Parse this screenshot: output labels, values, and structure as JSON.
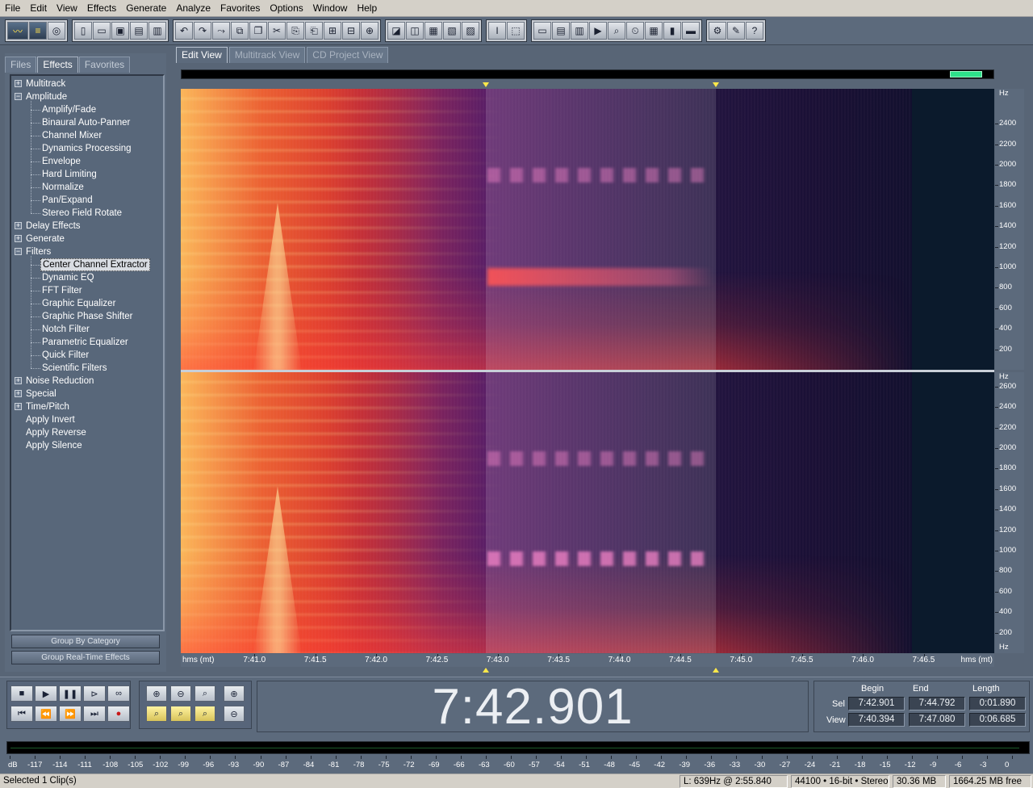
{
  "menu": [
    "File",
    "Edit",
    "View",
    "Effects",
    "Generate",
    "Analyze",
    "Favorites",
    "Options",
    "Window",
    "Help"
  ],
  "left_tabs": [
    "Files",
    "Effects",
    "Favorites"
  ],
  "left_active_tab": "Effects",
  "tree": [
    {
      "label": "Multitrack",
      "level": 0,
      "expander": "+"
    },
    {
      "label": "Amplitude",
      "level": 0,
      "expander": "-"
    },
    {
      "label": "Amplify/Fade",
      "level": 1
    },
    {
      "label": "Binaural Auto-Panner",
      "level": 1
    },
    {
      "label": "Channel Mixer",
      "level": 1
    },
    {
      "label": "Dynamics Processing",
      "level": 1
    },
    {
      "label": "Envelope",
      "level": 1
    },
    {
      "label": "Hard Limiting",
      "level": 1
    },
    {
      "label": "Normalize",
      "level": 1
    },
    {
      "label": "Pan/Expand",
      "level": 1
    },
    {
      "label": "Stereo Field Rotate",
      "level": 1
    },
    {
      "label": "Delay Effects",
      "level": 0,
      "expander": "+"
    },
    {
      "label": "Generate",
      "level": 0,
      "expander": "+"
    },
    {
      "label": "Filters",
      "level": 0,
      "expander": "-"
    },
    {
      "label": "Center Channel Extractor",
      "level": 1,
      "selected": true
    },
    {
      "label": "Dynamic EQ",
      "level": 1
    },
    {
      "label": "FFT Filter",
      "level": 1
    },
    {
      "label": "Graphic Equalizer",
      "level": 1
    },
    {
      "label": "Graphic Phase Shifter",
      "level": 1
    },
    {
      "label": "Notch Filter",
      "level": 1
    },
    {
      "label": "Parametric Equalizer",
      "level": 1
    },
    {
      "label": "Quick Filter",
      "level": 1
    },
    {
      "label": "Scientific Filters",
      "level": 1
    },
    {
      "label": "Noise Reduction",
      "level": 0,
      "expander": "+"
    },
    {
      "label": "Special",
      "level": 0,
      "expander": "+"
    },
    {
      "label": "Time/Pitch",
      "level": 0,
      "expander": "+"
    },
    {
      "label": "Apply Invert",
      "level": 0
    },
    {
      "label": "Apply Reverse",
      "level": 0
    },
    {
      "label": "Apply Silence",
      "level": 0
    }
  ],
  "left_buttons": {
    "group_by_category": "Group By Category",
    "group_realtime": "Group Real-Time Effects"
  },
  "view_tabs": [
    "Edit View",
    "Multitrack View",
    "CD Project View"
  ],
  "view_active_tab": "Edit View",
  "hz_unit": "Hz",
  "hz_labels_top": [
    "2400",
    "2200",
    "2000",
    "1800",
    "1600",
    "1400",
    "1200",
    "1000",
    "800",
    "600",
    "400",
    "200"
  ],
  "hz_labels_bottom": [
    "2600",
    "2400",
    "2200",
    "2000",
    "1800",
    "1600",
    "1400",
    "1200",
    "1000",
    "800",
    "600",
    "400",
    "200"
  ],
  "time_unit": "hms (mt)",
  "time_labels": [
    "7:41.0",
    "7:41.5",
    "7:42.0",
    "7:42.5",
    "7:43.0",
    "7:43.5",
    "7:44.0",
    "7:44.5",
    "7:45.0",
    "7:45.5",
    "7:46.0",
    "7:46.5"
  ],
  "time_view_start": 7.40394,
  "time_view_end": 7.4708,
  "selection_start_fraction": 0.375,
  "selection_end_fraction": 0.6575,
  "current_time": "7:42.901",
  "selview": {
    "headers": {
      "begin": "Begin",
      "end": "End",
      "length": "Length"
    },
    "sel_label": "Sel",
    "view_label": "View",
    "sel": {
      "begin": "7:42.901",
      "end": "7:44.792",
      "length": "0:01.890"
    },
    "view": {
      "begin": "7:40.394",
      "end": "7:47.080",
      "length": "0:06.685"
    }
  },
  "db_labels": [
    "dB",
    "-117",
    "-114",
    "-111",
    "-108",
    "-105",
    "-102",
    "-99",
    "-96",
    "-93",
    "-90",
    "-87",
    "-84",
    "-81",
    "-78",
    "-75",
    "-72",
    "-69",
    "-66",
    "-63",
    "-60",
    "-57",
    "-54",
    "-51",
    "-48",
    "-45",
    "-42",
    "-39",
    "-36",
    "-33",
    "-30",
    "-27",
    "-24",
    "-21",
    "-18",
    "-15",
    "-12",
    "-9",
    "-6",
    "-3",
    "0"
  ],
  "status": {
    "clips": "Selected 1 Clip(s)",
    "cursor": "L: 639Hz @  2:55.840",
    "format": "44100 • 16-bit • Stereo",
    "size": "30.36 MB",
    "free": "1664.25 MB free"
  },
  "colors": {
    "panel": "#5c6a7c",
    "spectro_hot": "#e1331f",
    "spectro_cool": "#3a1752",
    "selection_marker": "#ffe94a",
    "meter_thumb": "#2ee08a"
  }
}
